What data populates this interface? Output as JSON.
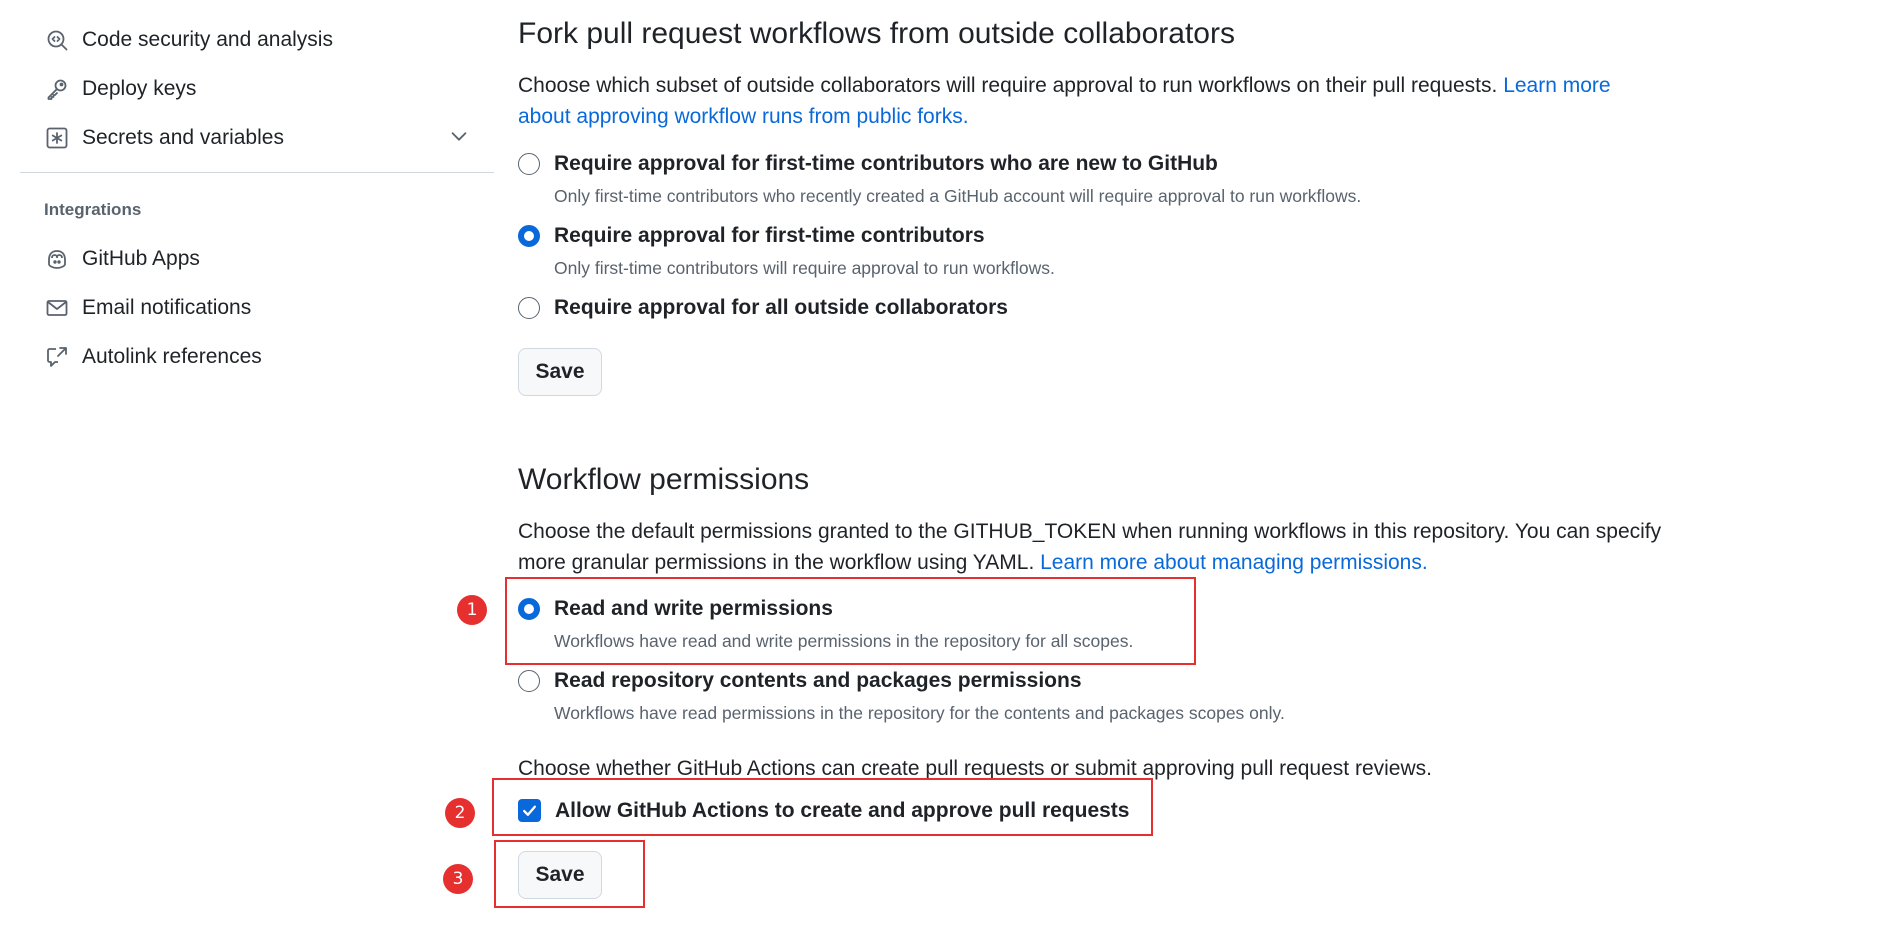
{
  "sidebar": {
    "items_top": [
      {
        "label": "Code security and analysis",
        "icon": "codescan-icon"
      },
      {
        "label": "Deploy keys",
        "icon": "key-icon"
      },
      {
        "label": "Secrets and variables",
        "icon": "asterisk-icon"
      }
    ],
    "integrations_heading": "Integrations",
    "items_integrations": [
      {
        "label": "GitHub Apps",
        "icon": "copilot-apps-icon"
      },
      {
        "label": "Email notifications",
        "icon": "mail-icon"
      },
      {
        "label": "Autolink references",
        "icon": "cross-reference-icon"
      }
    ]
  },
  "fork_section": {
    "title": "Fork pull request workflows from outside collaborators",
    "description": "Choose which subset of outside collaborators will require approval to run workflows on their pull requests.",
    "link": "Learn more about approving workflow runs from public forks.",
    "options": [
      {
        "label": "Require approval for first-time contributors who are new to GitHub",
        "sub": "Only first-time contributors who recently created a GitHub account will require approval to run workflows.",
        "checked": false
      },
      {
        "label": "Require approval for first-time contributors",
        "sub": "Only first-time contributors will require approval to run workflows.",
        "checked": true
      },
      {
        "label": "Require approval for all outside collaborators",
        "sub": "",
        "checked": false
      }
    ],
    "save_label": "Save"
  },
  "workflow_permissions": {
    "title": "Workflow permissions",
    "description": "Choose the default permissions granted to the GITHUB_TOKEN when running workflows in this repository. You can specify more granular permissions in the workflow using YAML.",
    "link": "Learn more about managing permissions.",
    "options": [
      {
        "label": "Read and write permissions",
        "sub": "Workflows have read and write permissions in the repository for all scopes.",
        "checked": true
      },
      {
        "label": "Read repository contents and packages permissions",
        "sub": "Workflows have read permissions in the repository for the contents and packages scopes only.",
        "checked": false
      }
    ],
    "pr_description": "Choose whether GitHub Actions can create pull requests or submit approving pull request reviews.",
    "checkbox_label": "Allow GitHub Actions to create and approve pull requests",
    "checkbox_checked": true,
    "save_label": "Save"
  },
  "annotations": [
    "1",
    "2",
    "3"
  ],
  "colors": {
    "accent": "#0969da",
    "annotation": "#e5302f",
    "muted": "#59636e"
  }
}
